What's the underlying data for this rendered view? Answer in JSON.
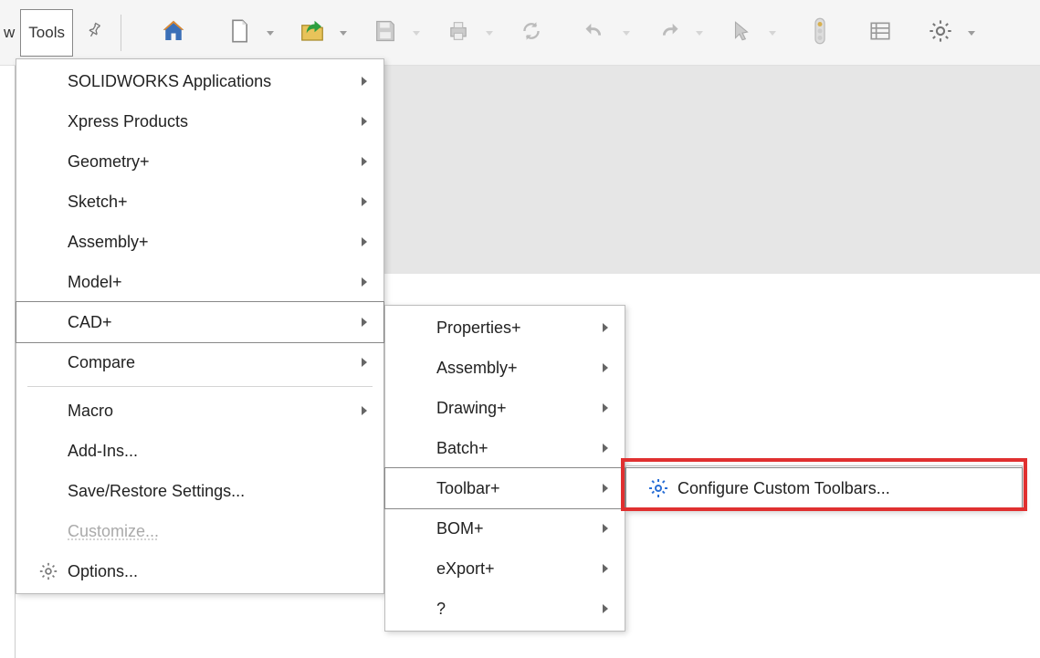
{
  "menubar": {
    "cut_item": "w",
    "tools_label": "Tools"
  },
  "tools_menu": [
    {
      "label": "SOLIDWORKS Applications",
      "submenu": true
    },
    {
      "label": "Xpress Products",
      "submenu": true
    },
    {
      "label": "Geometry+",
      "submenu": true
    },
    {
      "label": "Sketch+",
      "submenu": true
    },
    {
      "label": "Assembly+",
      "submenu": true
    },
    {
      "label": "Model+",
      "submenu": true
    },
    {
      "label": "CAD+",
      "submenu": true,
      "highlight": true
    },
    {
      "label": "Compare",
      "submenu": true
    },
    {
      "sep": true
    },
    {
      "label": "Macro",
      "submenu": true
    },
    {
      "label": "Add-Ins..."
    },
    {
      "label": "Save/Restore Settings..."
    },
    {
      "label": "Customize...",
      "disabled": true
    },
    {
      "label": "Options...",
      "icon": "gear"
    }
  ],
  "cad_menu": [
    {
      "label": "Properties+",
      "submenu": true
    },
    {
      "label": "Assembly+",
      "submenu": true
    },
    {
      "label": "Drawing+",
      "submenu": true
    },
    {
      "label": "Batch+",
      "submenu": true
    },
    {
      "label": "Toolbar+",
      "submenu": true,
      "highlight": true
    },
    {
      "label": "BOM+",
      "submenu": true
    },
    {
      "label": "eXport+",
      "submenu": true
    },
    {
      "label": "?",
      "submenu": true
    }
  ],
  "toolbar_menu": {
    "configure_label": "Configure Custom Toolbars..."
  }
}
